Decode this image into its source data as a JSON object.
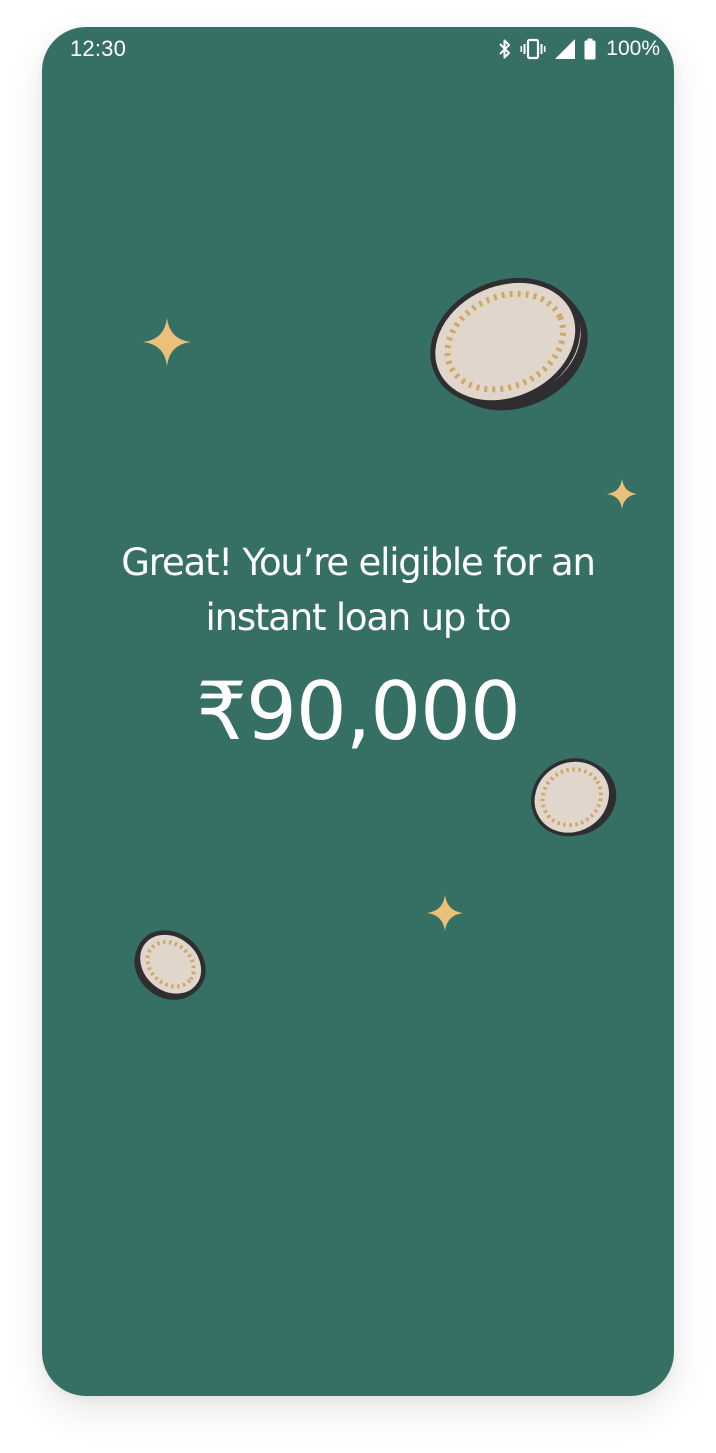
{
  "status_bar": {
    "time": "12:30",
    "battery_percent": "100%",
    "icons": [
      "bluetooth-icon",
      "vibrate-icon",
      "cellular-signal-icon",
      "battery-icon"
    ]
  },
  "eligibility": {
    "line1": "Great! You’re eligible for an",
    "line2": "instant loan up to",
    "amount": "₹90,000"
  },
  "theme": {
    "background": "#367064",
    "text": "#FFFFFF",
    "sparkle": "#EBC07A",
    "coin_face": "#E0D6CC",
    "coin_outline": "#2E2E30",
    "coin_dashes": "#D0A865"
  }
}
